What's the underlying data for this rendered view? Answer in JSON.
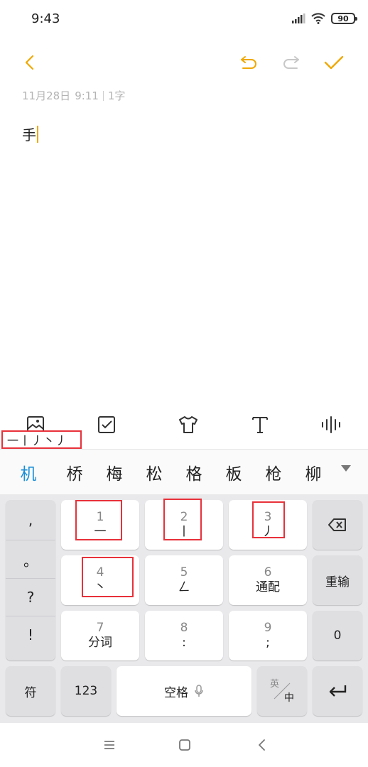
{
  "status_bar": {
    "time": "9:43",
    "battery": "90"
  },
  "note": {
    "date": "11月28日",
    "time": "9:11",
    "char_count": "1字",
    "content": "手"
  },
  "colors": {
    "accent": "#f0a800",
    "candidate_highlight": "#1a8fd8",
    "annotation_box": "#e8313a"
  },
  "input_strokes": "一丨丿丶丿",
  "candidates": [
    "机",
    "桥",
    "梅",
    "松",
    "格",
    "板",
    "枪",
    "柳"
  ],
  "punctuation": [
    ",",
    "。",
    "?",
    "!"
  ],
  "keys": {
    "k1": {
      "num": "1",
      "sub": "一"
    },
    "k2": {
      "num": "2",
      "sub": "丨"
    },
    "k3": {
      "num": "3",
      "sub": "丿"
    },
    "k4": {
      "num": "4",
      "sub": "丶"
    },
    "k5": {
      "num": "5",
      "sub": "ㄥ"
    },
    "k6": {
      "num": "6",
      "sub": "通配"
    },
    "k7": {
      "num": "7",
      "sub": "分词"
    },
    "k8": {
      "num": "8",
      "sub": ":"
    },
    "k9": {
      "num": "9",
      "sub": ";"
    },
    "reinput": "重输",
    "zero": "0",
    "symbols": "符",
    "numbers": "123",
    "space": "空格",
    "lang_en": "英",
    "lang_zh": "中"
  },
  "icons": {
    "back": "chevron-left-icon",
    "undo": "undo-icon",
    "redo": "redo-icon",
    "done": "check-icon",
    "image": "image-icon",
    "checklist": "checkbox-icon",
    "theme": "shirt-icon",
    "text_format": "text-format-icon",
    "voice": "waveform-icon",
    "backspace": "backspace-icon",
    "enter": "enter-icon",
    "mic": "mic-icon",
    "nav_menu": "menu-icon",
    "nav_home": "home-square-icon",
    "nav_back": "nav-back-icon"
  }
}
